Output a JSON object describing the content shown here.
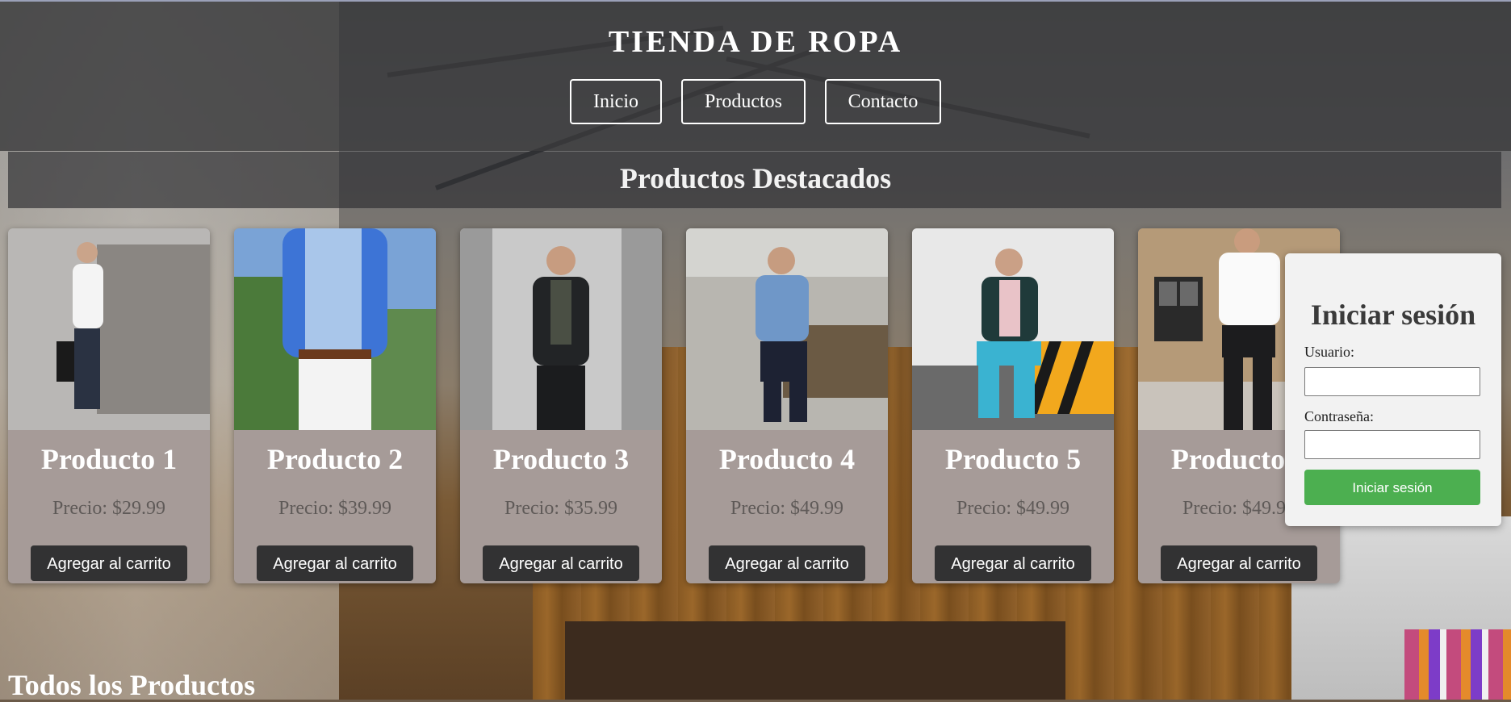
{
  "header": {
    "brand": "TIENDA DE ROPA",
    "nav": [
      {
        "label": "Inicio"
      },
      {
        "label": "Productos"
      },
      {
        "label": "Contacto"
      }
    ]
  },
  "featured": {
    "title": "Productos Destacados"
  },
  "products": [
    {
      "name": "Producto 1",
      "price": "Precio: $29.99",
      "button": "Agregar al carrito",
      "shirt": "#f4f4f4",
      "pants": "#2a3242",
      "bg": "#b9b7b5"
    },
    {
      "name": "Producto 2",
      "price": "Precio: $39.99",
      "button": "Agregar al carrito",
      "shirt": "#3d74d6",
      "pants": "#f3f3f3",
      "bg": "#5f8a4e"
    },
    {
      "name": "Producto 3",
      "price": "Precio: $35.99",
      "button": "Agregar al carrito",
      "shirt": "#222426",
      "pants": "#1b1c1e",
      "bg": "#c9c9c9"
    },
    {
      "name": "Producto 4",
      "price": "Precio: $49.99",
      "button": "Agregar al carrito",
      "shirt": "#6f97c8",
      "pants": "#1d2233",
      "bg": "#9a9a95"
    },
    {
      "name": "Producto 5",
      "price": "Precio: $49.99",
      "button": "Agregar al carrito",
      "shirt": "#1f3a3a",
      "pants": "#3ab3d1",
      "bg": "#e8e8e8"
    },
    {
      "name": "Producto 6",
      "price": "Precio: $49.99",
      "button": "Agregar al carrito",
      "shirt": "#fafafa",
      "pants": "#1c1c1e",
      "bg": "#b59a78"
    }
  ],
  "login": {
    "title": "Iniciar sesión",
    "user_label": "Usuario:",
    "user_value": "",
    "pass_label": "Contraseña:",
    "pass_value": "",
    "submit": "Iniciar sesión",
    "submit_color": "#4caf50"
  },
  "all_products": {
    "title": "Todos los Productos"
  }
}
